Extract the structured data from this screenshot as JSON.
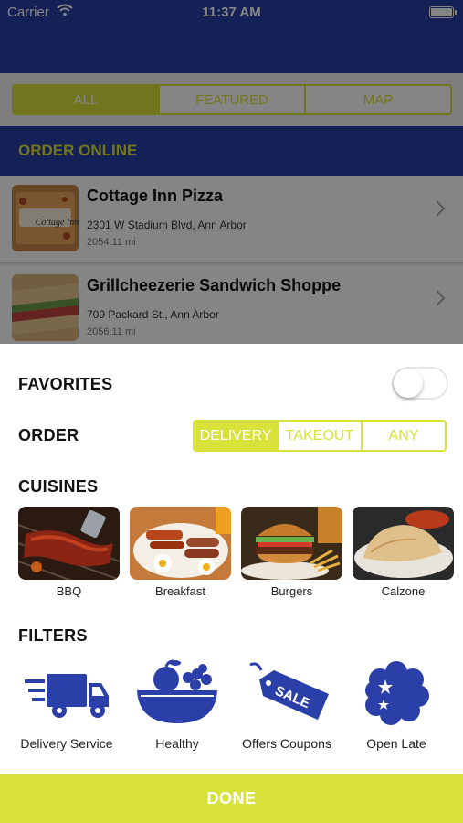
{
  "status_bar": {
    "carrier": "Carrier",
    "time": "11:37 AM"
  },
  "top_tabs": [
    {
      "label": "ALL",
      "active": true
    },
    {
      "label": "FEATURED",
      "active": false
    },
    {
      "label": "MAP",
      "active": false
    }
  ],
  "section_title": "ORDER ONLINE",
  "restaurants": [
    {
      "name": "Cottage Inn Pizza",
      "address": "2301 W Stadium Blvd, Ann Arbor",
      "distance": "2054.11 mi",
      "logo_text": "Cottage Inn"
    },
    {
      "name": "Grillcheezerie Sandwich Shoppe",
      "address": "709 Packard St., Ann Arbor",
      "distance": "2056.11 mi"
    }
  ],
  "favorites": {
    "label": "FAVORITES",
    "enabled": false
  },
  "order": {
    "label": "ORDER",
    "options": [
      {
        "label": "DELIVERY",
        "active": true
      },
      {
        "label": "TAKEOUT",
        "active": false
      },
      {
        "label": "ANY",
        "active": false
      }
    ]
  },
  "cuisines": {
    "label": "CUISINES",
    "items": [
      {
        "label": "BBQ"
      },
      {
        "label": "Breakfast"
      },
      {
        "label": "Burgers"
      },
      {
        "label": "Calzone"
      }
    ]
  },
  "filters": {
    "label": "FILTERS",
    "items": [
      {
        "label": "Delivery Service",
        "icon": "delivery-truck-icon"
      },
      {
        "label": "Healthy",
        "icon": "fruit-basket-icon"
      },
      {
        "label": "Offers Coupons",
        "icon": "sale-tag-icon"
      },
      {
        "label": "Open Late",
        "icon": "moon-stars-icon"
      }
    ],
    "sale_tag_text": "SALE"
  },
  "done_label": "DONE",
  "colors": {
    "primary_blue": "#2a3fa8",
    "accent_yellow": "#d9e23a"
  }
}
